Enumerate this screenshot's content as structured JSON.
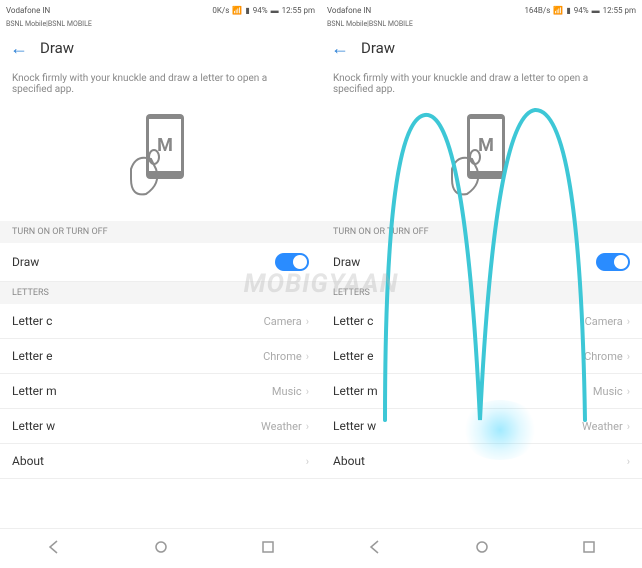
{
  "left": {
    "status": {
      "carrier": "Vodafone IN",
      "carrier2": "BSNL Mobile|BSNL MOBILE",
      "speed": "0K/s",
      "battery": "94%",
      "time": "12:55 pm"
    },
    "header": {
      "title": "Draw"
    },
    "description": "Knock firmly with your knuckle and draw a letter to open a specified app.",
    "sections": {
      "toggle_header": "TURN ON OR TURN OFF",
      "letters_header": "LETTERS"
    },
    "toggle": {
      "label": "Draw"
    },
    "letters": [
      {
        "label": "Letter c",
        "value": "Camera"
      },
      {
        "label": "Letter e",
        "value": "Chrome"
      },
      {
        "label": "Letter m",
        "value": "Music"
      },
      {
        "label": "Letter w",
        "value": "Weather"
      }
    ],
    "about": {
      "label": "About"
    }
  },
  "right": {
    "status": {
      "carrier": "Vodafone IN",
      "carrier2": "BSNL Mobile|BSNL MOBILE",
      "speed": "164B/s",
      "battery": "94%",
      "time": "12:55 pm"
    },
    "header": {
      "title": "Draw"
    },
    "description": "Knock firmly with your knuckle and draw a letter to open a specified app.",
    "sections": {
      "toggle_header": "TURN ON OR TURN OFF",
      "letters_header": "LETTERS"
    },
    "toggle": {
      "label": "Draw"
    },
    "letters": [
      {
        "label": "Letter c",
        "value": "Camera"
      },
      {
        "label": "Letter e",
        "value": "Chrome"
      },
      {
        "label": "Letter m",
        "value": "Music"
      },
      {
        "label": "Letter w",
        "value": "Weather"
      }
    ],
    "about": {
      "label": "About"
    }
  },
  "watermark": "MOBIGYAAN",
  "illustration_letter": "M",
  "gesture_color": "#3dc7d6"
}
